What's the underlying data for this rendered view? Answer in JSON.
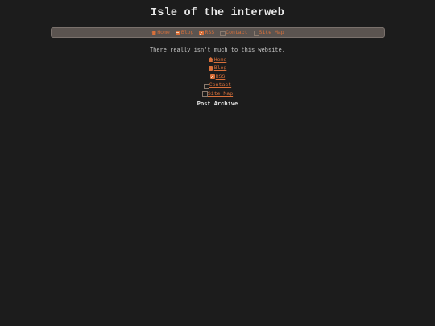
{
  "site": {
    "title": "Isle of the interweb",
    "tagline": "There really isn't much to this website."
  },
  "nav": {
    "items": [
      {
        "label": "Home",
        "icon": "home-icon"
      },
      {
        "label": "Blog",
        "icon": "blog-icon"
      },
      {
        "label": "RSS",
        "icon": "rss-icon"
      },
      {
        "label": "Contact",
        "icon": "contact-icon"
      },
      {
        "label": "Site Map",
        "icon": "map-icon"
      }
    ]
  },
  "links": {
    "items": [
      {
        "label": "Home",
        "icon": "home-icon"
      },
      {
        "label": "Blog",
        "icon": "blog-icon"
      },
      {
        "label": "RSS",
        "icon": "rss-icon"
      },
      {
        "label": "Contact",
        "icon": "contact-icon"
      },
      {
        "label": "Site Map",
        "icon": "map-icon"
      }
    ]
  },
  "archive": {
    "heading": "Post Archive"
  },
  "colors": {
    "background": "#1c1c1c",
    "link": "#d9703a",
    "nav_bar": "#5b5450"
  }
}
